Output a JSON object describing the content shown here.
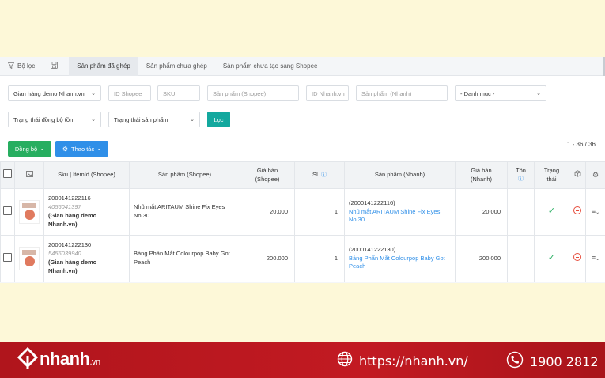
{
  "tabs": [
    {
      "label": "Bộ lọc",
      "icon": "filter-icon"
    },
    {
      "label": "",
      "icon": "save-icon"
    },
    {
      "label": "Sản phẩm đã ghép",
      "active": true
    },
    {
      "label": "Sản phẩm chưa ghép"
    },
    {
      "label": "Sản phẩm chưa tạo sang Shopee"
    }
  ],
  "filters": {
    "store_select": "Gian hàng demo Nhanh.vn",
    "shopee_id_placeholder": "ID Shopee",
    "sku_placeholder": "SKU",
    "shopee_product_placeholder": "Sản phẩm (Shopee)",
    "nhanh_id_placeholder": "ID Nhanh.vn",
    "nhanh_product_placeholder": "Sản phẩm (Nhanh)",
    "category_select": "- Danh mục -",
    "sync_status_select": "Trạng thái đồng bộ tồn",
    "product_status_select": "Trạng thái sản phẩm",
    "filter_button": "Lọc"
  },
  "actions": {
    "sync_button": "Đồng bộ",
    "operations_button": "Thao tác",
    "count": "1 - 36 / 36"
  },
  "table": {
    "headers": {
      "sku": "Sku | ItemId (Shopee)",
      "shopee_product": "Sản phẩm (Shopee)",
      "shopee_price_1": "Giá bán",
      "shopee_price_2": "(Shopee)",
      "qty": "SL",
      "nhanh_product": "Sản phẩm (Nhanh)",
      "nhanh_price_1": "Giá bán",
      "nhanh_price_2": "(Nhanh)",
      "stock": "Tồn",
      "status_1": "Trạng",
      "status_2": "thái"
    },
    "rows": [
      {
        "sku": "2000141222116",
        "item_id": "4056041397",
        "store_1": "(Gian hàng demo",
        "store_2": "Nhanh.vn)",
        "shopee_product": "Nhũ mắt ARITAUM Shine Fix Eyes No.30",
        "shopee_price": "20.000",
        "qty": "1",
        "nhanh_code": "(2000141222116)",
        "nhanh_product": "Nhũ mắt ARITAUM Shine Fix Eyes No.30",
        "nhanh_price": "20.000"
      },
      {
        "sku": "2000141222130",
        "item_id": "5456039940",
        "store_1": "(Gian hàng demo",
        "store_2": "Nhanh.vn)",
        "shopee_product": "Bảng Phấn Mắt Colourpop Baby Got Peach",
        "shopee_price": "200.000",
        "qty": "1",
        "nhanh_code": "(2000141222130)",
        "nhanh_product": "Bảng Phấn Mắt Colourpop Baby Got Peach",
        "nhanh_price": "200.000"
      }
    ]
  },
  "footer": {
    "brand": "nhanh",
    "brand_suffix": ".vn",
    "website": "https://nhanh.vn/",
    "phone": "1900 2812"
  },
  "colors": {
    "accent_green": "#27ae60",
    "accent_blue": "#2f8fe8",
    "footer_red": "#c21a22",
    "banner_yellow": "#fdf8d8"
  }
}
